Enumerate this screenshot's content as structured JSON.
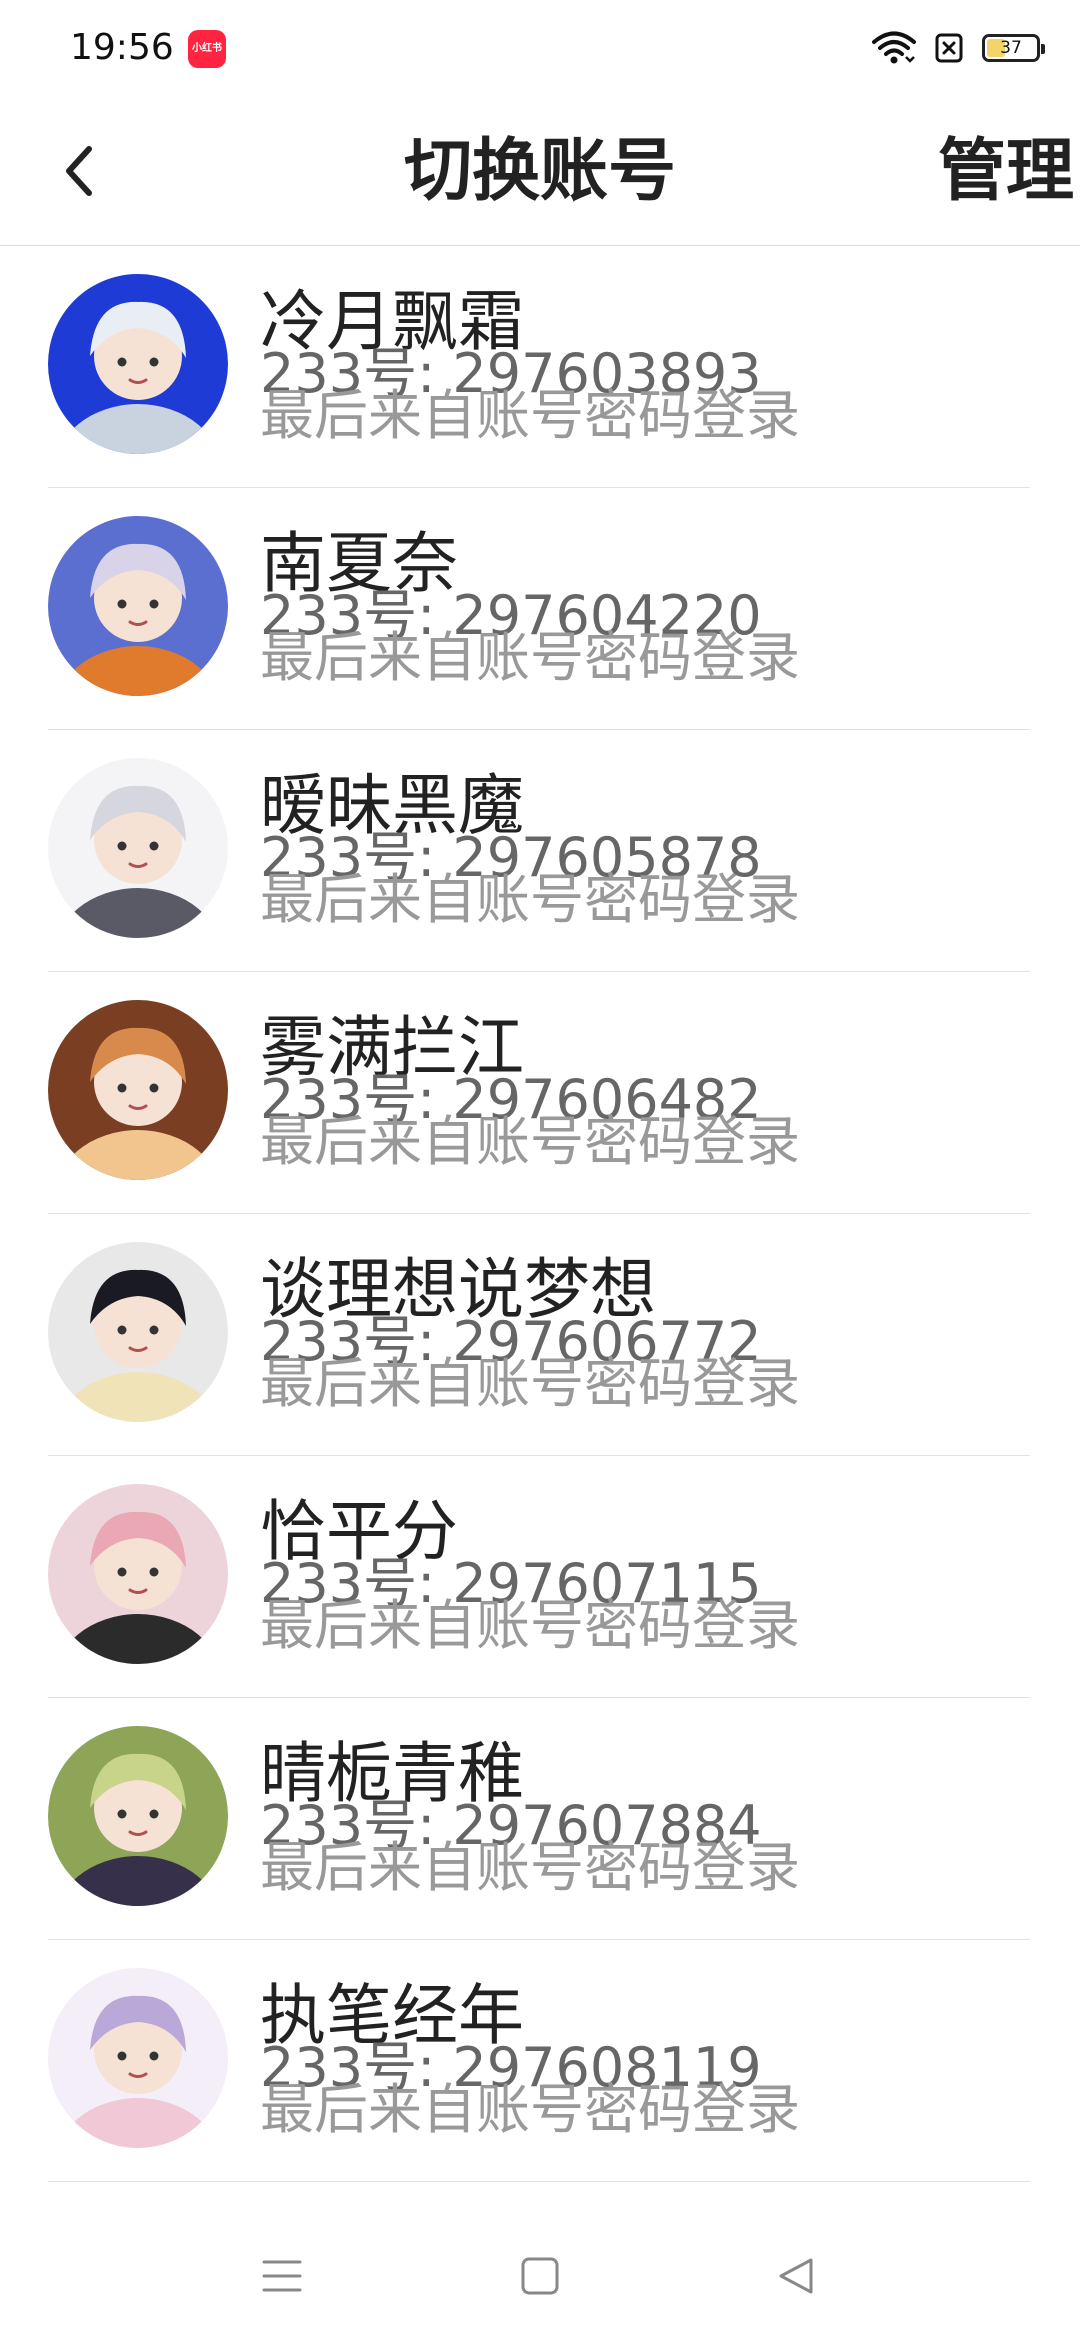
{
  "status_bar": {
    "time": "19:56",
    "app_badge": "小红书",
    "battery_level": "37",
    "battery_fraction": 0.37
  },
  "header": {
    "back_icon": "chevron-left-icon",
    "title": "切换账号",
    "manage_label": "管理"
  },
  "accounts": [
    {
      "name": "冷月飘霜",
      "id": "233号: 297603893",
      "login": "最后来自账号密码登录",
      "avatar_colors": [
        "#1f3bd6",
        "#e9eef5",
        "#c9d3df"
      ]
    },
    {
      "name": "南夏奈",
      "id": "233号: 297604220",
      "login": "最后来自账号密码登录",
      "avatar_colors": [
        "#5b6fd0",
        "#d8d3e8",
        "#e07a2c"
      ]
    },
    {
      "name": "暧昧黑魔",
      "id": "233号: 297605878",
      "login": "最后来自账号密码登录",
      "avatar_colors": [
        "#f4f4f6",
        "#d6d6de",
        "#5a5a66"
      ]
    },
    {
      "name": "雾满拦江",
      "id": "233号: 297606482",
      "login": "最后来自账号密码登录",
      "avatar_colors": [
        "#7a3e22",
        "#d88a4c",
        "#f2c48e"
      ]
    },
    {
      "name": "谈理想说梦想",
      "id": "233号: 297606772",
      "login": "最后来自账号密码登录",
      "avatar_colors": [
        "#e8e8e8",
        "#1a1a22",
        "#f1e3b8"
      ]
    },
    {
      "name": "恰平分",
      "id": "233号: 297607115",
      "login": "最后来自账号密码登录",
      "avatar_colors": [
        "#ecd4da",
        "#e9a8b4",
        "#2b2b2b"
      ]
    },
    {
      "name": "晴栀青稚",
      "id": "233号: 297607884",
      "login": "最后来自账号密码登录",
      "avatar_colors": [
        "#8ea456",
        "#c8d48a",
        "#36304a"
      ]
    },
    {
      "name": "执笔经年",
      "id": "233号: 297608119",
      "login": "最后来自账号密码登录",
      "avatar_colors": [
        "#f3eef7",
        "#b9a8d8",
        "#f0c8d6"
      ]
    }
  ],
  "nav_bar": {
    "menu_icon": "menu-icon",
    "home_icon": "square-home-icon",
    "back_icon": "triangle-back-icon"
  }
}
